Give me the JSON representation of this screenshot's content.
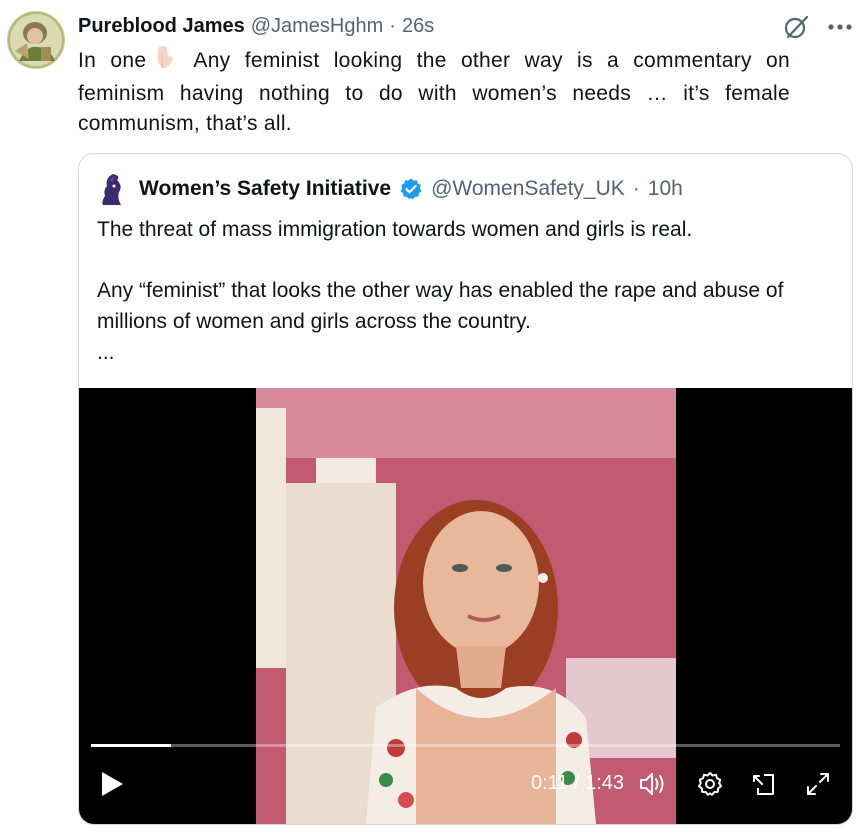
{
  "tweet": {
    "author_name": "Pureblood James",
    "handle": "@JamesHghm",
    "separator": "·",
    "time": "26s",
    "text_prefix": "In one",
    "text_emoji": "point-down-emoji",
    "text_body": "Any feminist looking the other way is a commentary on feminism having nothing to do with women’s needs … it’s female communism, that’s all."
  },
  "quoted": {
    "author_name": "Women’s Safety Initiative",
    "handle": "@WomenSafety_UK",
    "separator": "·",
    "time": "10h",
    "paragraph1": "The threat of mass immigration towards women and girls is real.",
    "paragraph2": "Any “feminist” that looks the other way has enabled the rape and abuse of millions of women and girls across the country.",
    "ellipsis": "..."
  },
  "video": {
    "timecode": "0:11 / 1:43",
    "progress_fraction": 0.107
  },
  "icons": {
    "grok": "grok-icon",
    "more": "more-icon",
    "verified": "verified-badge-icon",
    "play": "play-icon",
    "volume": "volume-icon",
    "settings": "settings-icon",
    "popout": "popout-icon",
    "fullscreen": "fullscreen-icon"
  },
  "colors": {
    "verified": "#1d9bf0",
    "secondary_text": "#536471",
    "border": "#cfd9de"
  }
}
